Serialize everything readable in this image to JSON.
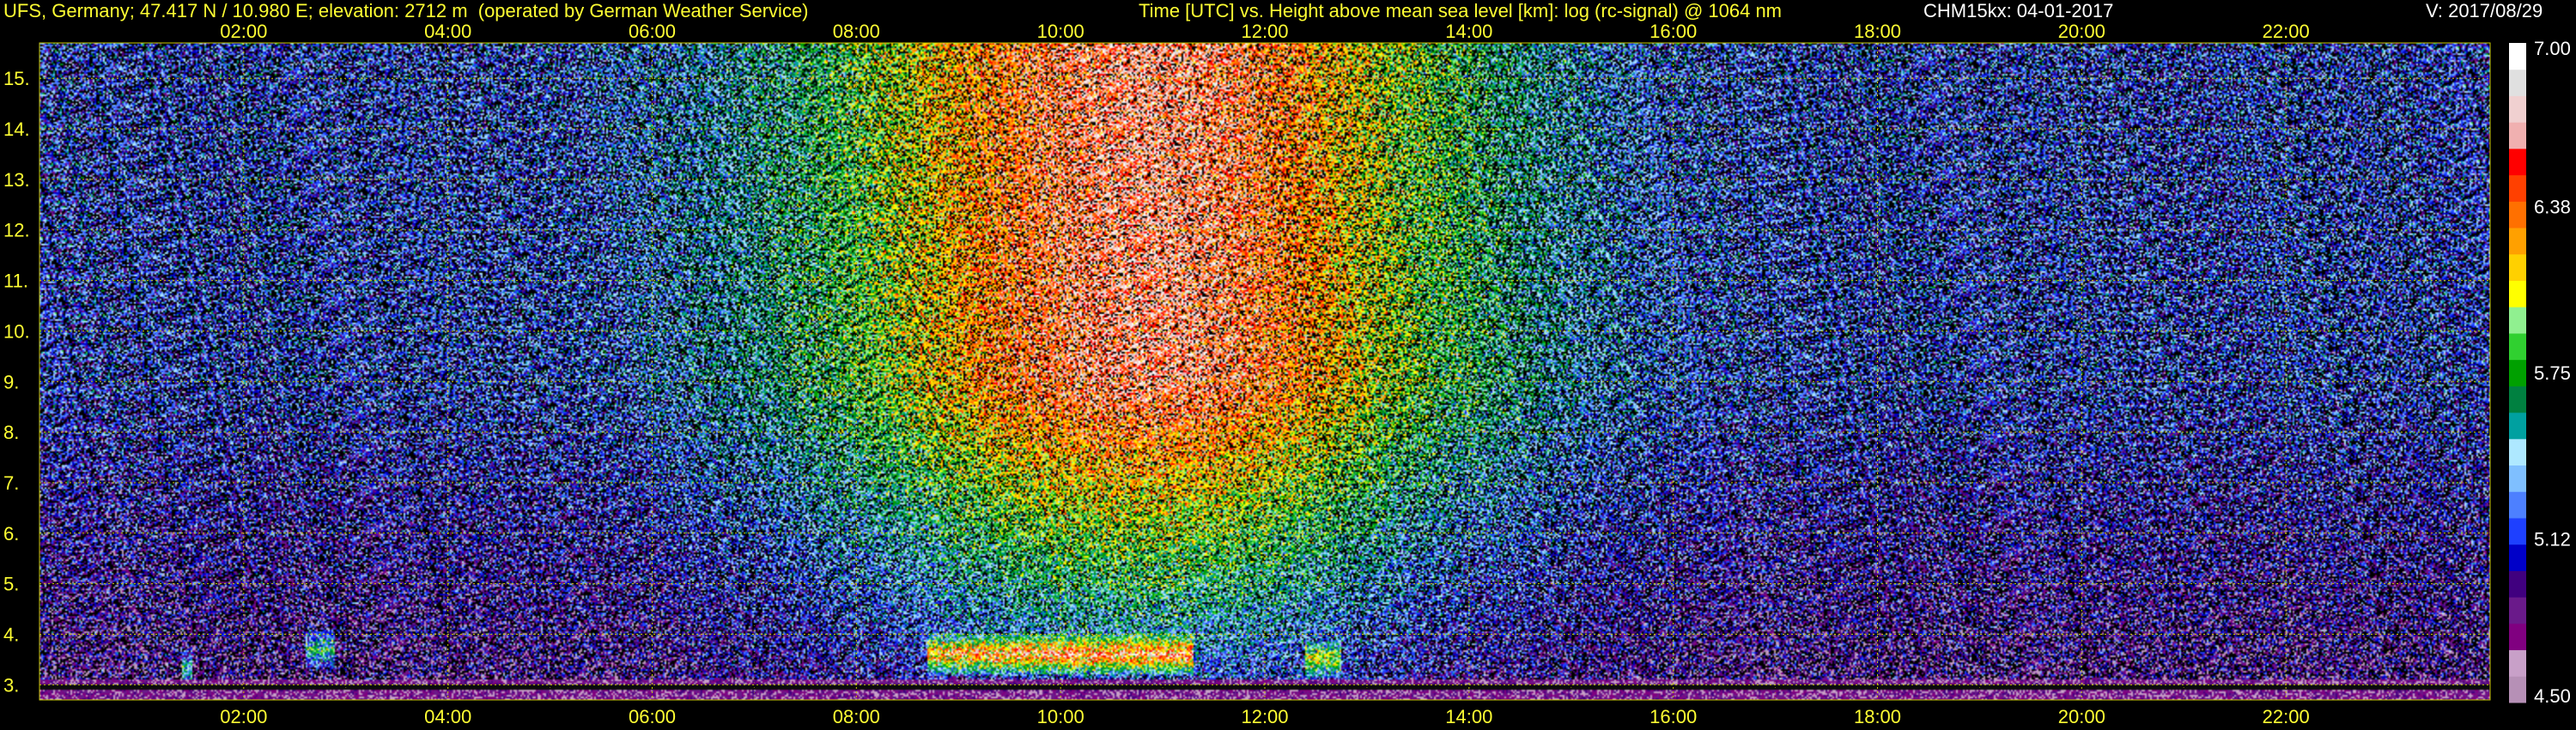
{
  "header": {
    "station": "UFS, Germany; 47.417 N / 10.980 E; elevation: 2712 m  (operated by German Weather Service)",
    "axes_desc": "Time [UTC] vs. Height above mean sea level [km]: log (rc-signal) @ 1064 nm",
    "instrument_date": "CHM15kx: 04-01-2017",
    "version": "V: 2017/08/29"
  },
  "colors": {
    "label_color": "#ffff33",
    "grid_color": "#c8c800",
    "background": "#000000"
  },
  "chart_data": {
    "type": "heatmap",
    "title": "Time [UTC] vs. Height above mean sea level [km]: log (rc-signal) @ 1064 nm",
    "xlabel": "Time [UTC]",
    "ylabel": "Height above mean sea level [km]",
    "xlim_hours": [
      0.0,
      24.0
    ],
    "ylim_km": [
      2.7,
      15.7
    ],
    "x_ticks": [
      "02:00",
      "04:00",
      "06:00",
      "08:00",
      "10:00",
      "12:00",
      "14:00",
      "16:00",
      "18:00",
      "20:00",
      "22:00"
    ],
    "x_tick_hours": [
      2,
      4,
      6,
      8,
      10,
      12,
      14,
      16,
      18,
      20,
      22
    ],
    "y_ticks": [
      "3.",
      "4.",
      "5.",
      "6.",
      "7.",
      "8.",
      "9.",
      "10.",
      "11.",
      "12.",
      "13.",
      "14.",
      "15."
    ],
    "y_tick_values": [
      3,
      4,
      5,
      6,
      7,
      8,
      9,
      10,
      11,
      12,
      13,
      14,
      15
    ],
    "grid": true,
    "colorbar": {
      "min": 4.5,
      "max": 7.0,
      "labels": [
        "7.00",
        "6.38",
        "5.75",
        "5.12",
        "4.50"
      ],
      "label_values": [
        7.0,
        6.38,
        5.75,
        5.12,
        4.5
      ],
      "side_mark": "eq",
      "colors": [
        "#b690b6",
        "#c8a0c8",
        "#800080",
        "#6a1a8a",
        "#40007f",
        "#0000c8",
        "#1e40ff",
        "#4d80ff",
        "#7fbfff",
        "#aee8ff",
        "#00a0a0",
        "#008040",
        "#00a000",
        "#30d030",
        "#90f090",
        "#ffff00",
        "#ffd000",
        "#ffa000",
        "#ff7000",
        "#ff4000",
        "#ff0000",
        "#f0b0b0",
        "#f0d0d0",
        "#e0e0e0",
        "#ffffff"
      ]
    },
    "features": {
      "sun_signal_center_hour": 10.8,
      "cloud_events": [
        {
          "start_hour": 8.7,
          "end_hour": 11.3,
          "height_km": 3.6,
          "intensity": "high"
        },
        {
          "start_hour": 12.4,
          "end_hour": 12.75,
          "height_km": 3.5,
          "intensity": "medium"
        },
        {
          "start_hour": 2.6,
          "end_hour": 2.9,
          "height_km": 3.7,
          "intensity": "medium"
        },
        {
          "start_hour": 1.4,
          "end_hour": 1.5,
          "height_km": 3.3,
          "intensity": "medium"
        }
      ]
    }
  }
}
